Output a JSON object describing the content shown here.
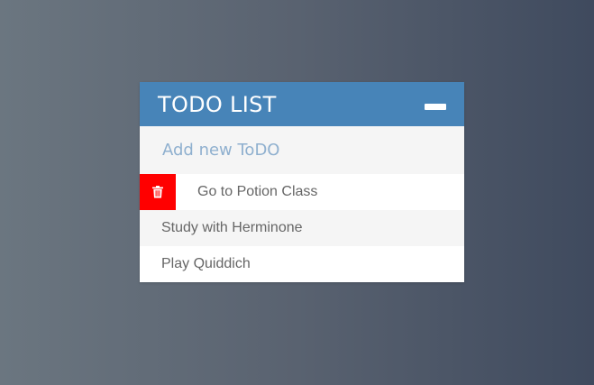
{
  "header": {
    "title": "TODO LIST",
    "collapse_icon": "minus-icon"
  },
  "new_todo": {
    "placeholder": "Add new ToDO"
  },
  "todos": [
    {
      "label": "Go to Potion Class",
      "delete_icon": "trash-icon"
    },
    {
      "label": "Study with Herminone"
    },
    {
      "label": "Play Quiddich"
    }
  ],
  "colors": {
    "header_bg": "#4784b8",
    "delete_bg": "#ff0000",
    "placeholder": "#8fb0cf"
  }
}
